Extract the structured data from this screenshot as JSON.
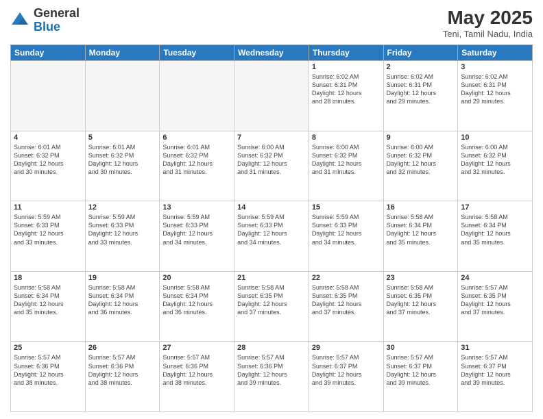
{
  "header": {
    "logo_general": "General",
    "logo_blue": "Blue",
    "month_title": "May 2025",
    "location": "Teni, Tamil Nadu, India"
  },
  "days_of_week": [
    "Sunday",
    "Monday",
    "Tuesday",
    "Wednesday",
    "Thursday",
    "Friday",
    "Saturday"
  ],
  "rows": [
    [
      {
        "day": "",
        "text": ""
      },
      {
        "day": "",
        "text": ""
      },
      {
        "day": "",
        "text": ""
      },
      {
        "day": "",
        "text": ""
      },
      {
        "day": "1",
        "text": "Sunrise: 6:02 AM\nSunset: 6:31 PM\nDaylight: 12 hours\nand 28 minutes."
      },
      {
        "day": "2",
        "text": "Sunrise: 6:02 AM\nSunset: 6:31 PM\nDaylight: 12 hours\nand 29 minutes."
      },
      {
        "day": "3",
        "text": "Sunrise: 6:02 AM\nSunset: 6:31 PM\nDaylight: 12 hours\nand 29 minutes."
      }
    ],
    [
      {
        "day": "4",
        "text": "Sunrise: 6:01 AM\nSunset: 6:32 PM\nDaylight: 12 hours\nand 30 minutes."
      },
      {
        "day": "5",
        "text": "Sunrise: 6:01 AM\nSunset: 6:32 PM\nDaylight: 12 hours\nand 30 minutes."
      },
      {
        "day": "6",
        "text": "Sunrise: 6:01 AM\nSunset: 6:32 PM\nDaylight: 12 hours\nand 31 minutes."
      },
      {
        "day": "7",
        "text": "Sunrise: 6:00 AM\nSunset: 6:32 PM\nDaylight: 12 hours\nand 31 minutes."
      },
      {
        "day": "8",
        "text": "Sunrise: 6:00 AM\nSunset: 6:32 PM\nDaylight: 12 hours\nand 31 minutes."
      },
      {
        "day": "9",
        "text": "Sunrise: 6:00 AM\nSunset: 6:32 PM\nDaylight: 12 hours\nand 32 minutes."
      },
      {
        "day": "10",
        "text": "Sunrise: 6:00 AM\nSunset: 6:32 PM\nDaylight: 12 hours\nand 32 minutes."
      }
    ],
    [
      {
        "day": "11",
        "text": "Sunrise: 5:59 AM\nSunset: 6:33 PM\nDaylight: 12 hours\nand 33 minutes."
      },
      {
        "day": "12",
        "text": "Sunrise: 5:59 AM\nSunset: 6:33 PM\nDaylight: 12 hours\nand 33 minutes."
      },
      {
        "day": "13",
        "text": "Sunrise: 5:59 AM\nSunset: 6:33 PM\nDaylight: 12 hours\nand 34 minutes."
      },
      {
        "day": "14",
        "text": "Sunrise: 5:59 AM\nSunset: 6:33 PM\nDaylight: 12 hours\nand 34 minutes."
      },
      {
        "day": "15",
        "text": "Sunrise: 5:59 AM\nSunset: 6:33 PM\nDaylight: 12 hours\nand 34 minutes."
      },
      {
        "day": "16",
        "text": "Sunrise: 5:58 AM\nSunset: 6:34 PM\nDaylight: 12 hours\nand 35 minutes."
      },
      {
        "day": "17",
        "text": "Sunrise: 5:58 AM\nSunset: 6:34 PM\nDaylight: 12 hours\nand 35 minutes."
      }
    ],
    [
      {
        "day": "18",
        "text": "Sunrise: 5:58 AM\nSunset: 6:34 PM\nDaylight: 12 hours\nand 35 minutes."
      },
      {
        "day": "19",
        "text": "Sunrise: 5:58 AM\nSunset: 6:34 PM\nDaylight: 12 hours\nand 36 minutes."
      },
      {
        "day": "20",
        "text": "Sunrise: 5:58 AM\nSunset: 6:34 PM\nDaylight: 12 hours\nand 36 minutes."
      },
      {
        "day": "21",
        "text": "Sunrise: 5:58 AM\nSunset: 6:35 PM\nDaylight: 12 hours\nand 37 minutes."
      },
      {
        "day": "22",
        "text": "Sunrise: 5:58 AM\nSunset: 6:35 PM\nDaylight: 12 hours\nand 37 minutes."
      },
      {
        "day": "23",
        "text": "Sunrise: 5:58 AM\nSunset: 6:35 PM\nDaylight: 12 hours\nand 37 minutes."
      },
      {
        "day": "24",
        "text": "Sunrise: 5:57 AM\nSunset: 6:35 PM\nDaylight: 12 hours\nand 37 minutes."
      }
    ],
    [
      {
        "day": "25",
        "text": "Sunrise: 5:57 AM\nSunset: 6:36 PM\nDaylight: 12 hours\nand 38 minutes."
      },
      {
        "day": "26",
        "text": "Sunrise: 5:57 AM\nSunset: 6:36 PM\nDaylight: 12 hours\nand 38 minutes."
      },
      {
        "day": "27",
        "text": "Sunrise: 5:57 AM\nSunset: 6:36 PM\nDaylight: 12 hours\nand 38 minutes."
      },
      {
        "day": "28",
        "text": "Sunrise: 5:57 AM\nSunset: 6:36 PM\nDaylight: 12 hours\nand 39 minutes."
      },
      {
        "day": "29",
        "text": "Sunrise: 5:57 AM\nSunset: 6:37 PM\nDaylight: 12 hours\nand 39 minutes."
      },
      {
        "day": "30",
        "text": "Sunrise: 5:57 AM\nSunset: 6:37 PM\nDaylight: 12 hours\nand 39 minutes."
      },
      {
        "day": "31",
        "text": "Sunrise: 5:57 AM\nSunset: 6:37 PM\nDaylight: 12 hours\nand 39 minutes."
      }
    ]
  ]
}
